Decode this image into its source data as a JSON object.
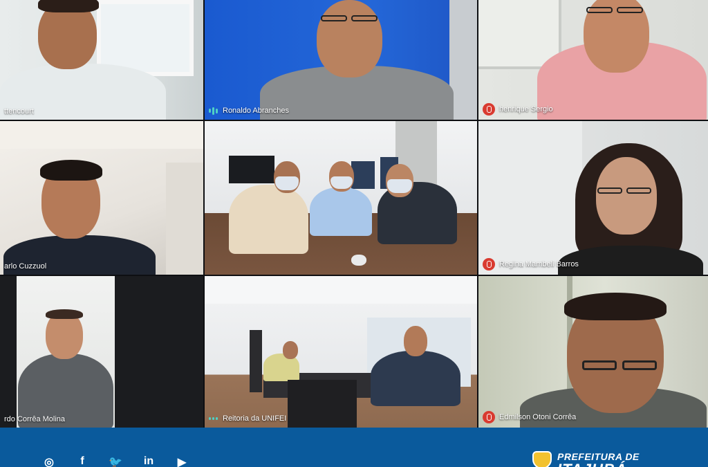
{
  "participants": [
    {
      "name": "ttencourt",
      "mic": "none"
    },
    {
      "name": "Ronaldo Abranches",
      "mic": "talking"
    },
    {
      "name": "henrique Sergio",
      "mic": "muted"
    },
    {
      "name": "arlo Cuzzuol",
      "mic": "none"
    },
    {
      "name": "",
      "mic": "none"
    },
    {
      "name": "Regina Mambeli Barros",
      "mic": "muted"
    },
    {
      "name": "rdo Corrêa Molina",
      "mic": "none"
    },
    {
      "name": "Reitoria da UNIFEI",
      "mic": "talking"
    },
    {
      "name": "Edmilson Otoni Corrêa",
      "mic": "muted"
    }
  ],
  "footer": {
    "social_icons": [
      "instagram-icon",
      "facebook-icon",
      "twitter-icon",
      "linkedin-icon",
      "youtube-icon"
    ],
    "social_glyphs": [
      "◎",
      "f",
      "🐦",
      "in",
      "▶"
    ],
    "brand_line1": "PREFEITURA DE",
    "brand_line2": "ITAJUBÁ"
  },
  "colors": {
    "footer_bg": "#0a5a9c",
    "mic_muted": "#d93b30",
    "talk_indicator": "#4fd1c5"
  }
}
